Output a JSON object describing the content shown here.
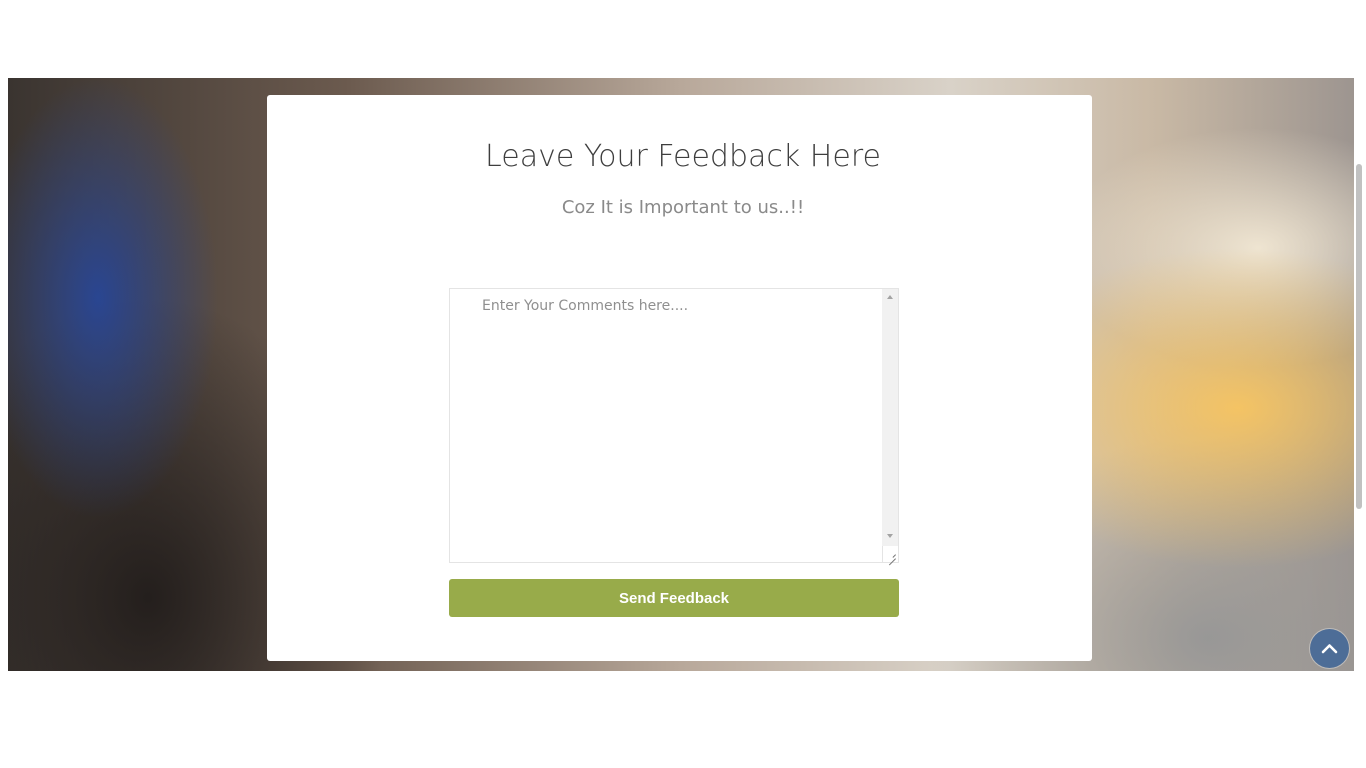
{
  "feedback": {
    "title": "Leave Your Feedback Here",
    "subtitle": "Coz It is Important to us..!!",
    "comments_placeholder": "Enter Your Comments here....",
    "comments_value": "",
    "send_label": "Send Feedback"
  },
  "colors": {
    "button": "#98ab4a",
    "back_to_top": "#4d6d97"
  },
  "icons": {
    "back_to_top": "chevron-up-icon"
  }
}
